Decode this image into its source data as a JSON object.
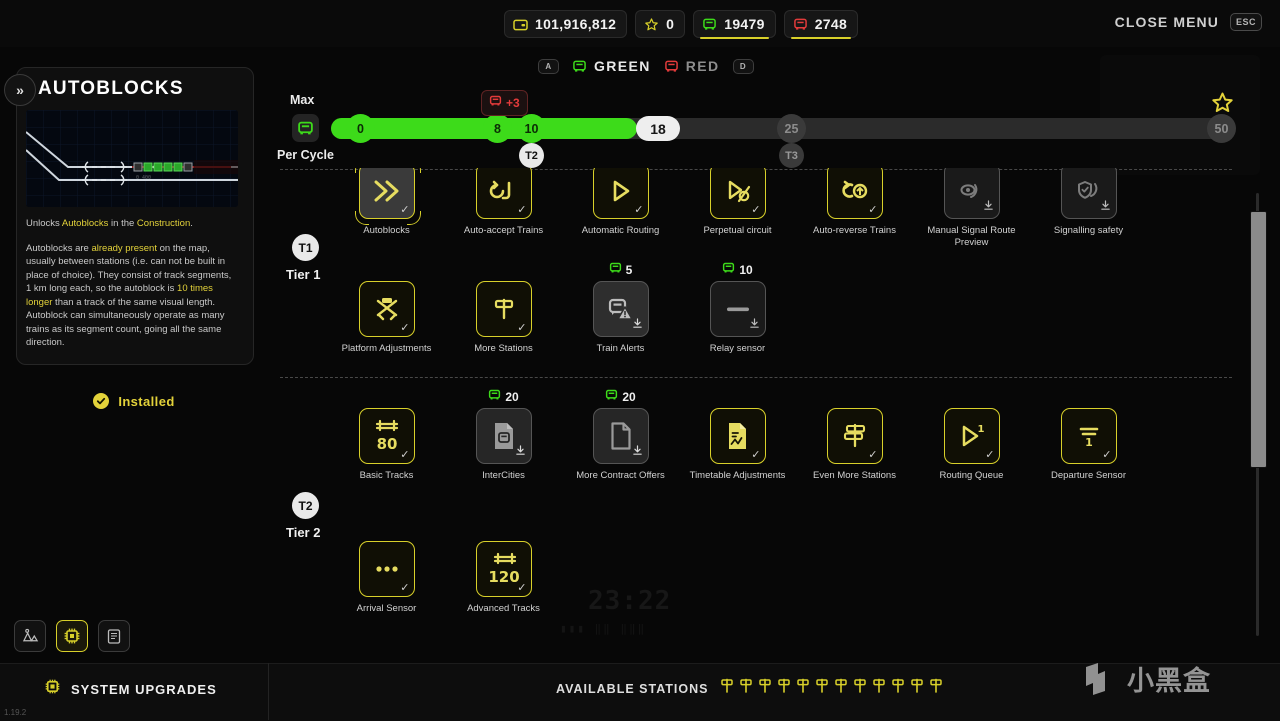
{
  "topbar": {
    "resources": [
      {
        "icon": "wallet-icon",
        "value": "101,916,812",
        "accent": "#d8d02a",
        "underline": false
      },
      {
        "icon": "star-icon",
        "value": "0",
        "accent": "#d8d02a",
        "underline": false
      },
      {
        "icon": "train-green-icon",
        "value": "19479",
        "accent": "#3ddb1a",
        "underline": true
      },
      {
        "icon": "train-red-icon",
        "value": "2748",
        "accent": "#e33b3b",
        "underline": true
      }
    ],
    "close_menu_label": "CLOSE MENU",
    "close_menu_key": "ESC"
  },
  "modes": {
    "left_key": "A",
    "right_key": "D",
    "items": [
      {
        "label": "GREEN",
        "color": "#3ddb1a"
      },
      {
        "label": "RED",
        "color": "#e33b3b"
      }
    ]
  },
  "detail_panel": {
    "collapse_icon": "»",
    "title": "AUTOBLOCKS",
    "unlock_line": {
      "pre": "Unlocks ",
      "hl1": "Autoblocks",
      "mid": " in the ",
      "hl2": "Construction",
      "post": "."
    },
    "description": {
      "s1": "Autoblocks are ",
      "hl1": "already present",
      "s2": " on the map, usually between stations (i.e. can not be built in place of choice). They consist of track segments, 1 km long each, so the autoblock is ",
      "hl2": "10 times longer",
      "s3": " than a track of the same visual length. Autoblock can simultaneously operate as many trains as its segment count, going all the same direction."
    },
    "status": "Installed"
  },
  "left_nav": {
    "items": [
      {
        "name": "construction-icon",
        "active": false
      },
      {
        "name": "chip-icon",
        "active": true
      },
      {
        "name": "book-icon",
        "active": false
      }
    ]
  },
  "bottom": {
    "system_upgrades_label": "SYSTEM UPGRADES",
    "version": "1.19.2",
    "available_stations_label": "AVAILABLE STATIONS",
    "available_stations_count": 12,
    "watermark": "小黑盒"
  },
  "slider": {
    "max_label": "Max",
    "per_cycle_label": "Per Cycle",
    "icon": "train-green-icon",
    "min": 0,
    "max": 50,
    "current": 18,
    "fill_end": 18,
    "stops": [
      {
        "value": 0,
        "label": "0",
        "pos_pct": 0,
        "active": true
      },
      {
        "value": 8,
        "label": "8",
        "pos_pct": 16,
        "active": true
      },
      {
        "value": 10,
        "label": "10",
        "pos_pct": 20,
        "active": true
      },
      {
        "value": 25,
        "label": "25",
        "pos_pct": 51,
        "active": false
      },
      {
        "value": 50,
        "label": "50",
        "pos_pct": 99,
        "active": false
      }
    ],
    "tier_markers": [
      {
        "label": "T2",
        "pos_pct": 20,
        "active": true
      },
      {
        "label": "T3",
        "pos_pct": 51,
        "active": false
      }
    ],
    "penalty_badge": {
      "icon": "train-red-icon",
      "text": "+3",
      "pos_pct": 16
    },
    "star_marker": "star-icon"
  },
  "upgrades": {
    "rows": [
      {
        "tier_chip": "",
        "tier_label": "",
        "items": [
          {
            "name": "Autoblocks",
            "icon": "chevrons-right-icon",
            "state": "selected",
            "mark": "check",
            "cost": null
          },
          {
            "name": "Auto-accept Trains",
            "icon": "auto-accept-icon",
            "state": "owned",
            "mark": "check",
            "cost": null
          },
          {
            "name": "Automatic Routing",
            "icon": "routing-icon",
            "state": "owned",
            "mark": "check",
            "cost": null
          },
          {
            "name": "Perpetual circuit",
            "icon": "perpetual-circuit-icon",
            "state": "owned",
            "mark": "check",
            "cost": null
          },
          {
            "name": "Auto-reverse Trains",
            "icon": "auto-reverse-icon",
            "state": "owned",
            "mark": "check",
            "cost": null
          },
          {
            "name": "Manual Signal Route Preview",
            "icon": "eye-signal-icon",
            "state": "locked",
            "mark": "download",
            "cost": null
          },
          {
            "name": "Signalling safety",
            "icon": "shield-signal-icon",
            "state": "locked",
            "mark": "download",
            "cost": null
          }
        ]
      },
      {
        "tier_chip": "T1",
        "tier_label": "Tier 1",
        "items": [
          {
            "name": "Platform Adjustments",
            "icon": "platform-adjust-icon",
            "state": "owned",
            "mark": "check",
            "cost": null
          },
          {
            "name": "More Stations",
            "icon": "signpost-icon",
            "state": "owned",
            "mark": "check",
            "cost": null
          },
          {
            "name": "Train Alerts",
            "icon": "train-alert-icon",
            "state": "locked",
            "mark": "download",
            "cost": {
              "icon": "train-green-icon",
              "value": "5"
            }
          },
          {
            "name": "Relay sensor",
            "icon": "relay-sensor-icon",
            "state": "locked",
            "mark": "download",
            "cost": {
              "icon": "train-green-icon",
              "value": "10"
            }
          }
        ]
      },
      {
        "tier_chip": "T2",
        "tier_label": "Tier 2",
        "items": [
          {
            "name": "Basic Tracks",
            "icon": "tracks-80-icon",
            "state": "owned",
            "mark": "check",
            "cost": null
          },
          {
            "name": "InterCities",
            "icon": "intercity-doc-icon",
            "state": "locked",
            "mark": "download",
            "cost": {
              "icon": "train-green-icon",
              "value": "20"
            }
          },
          {
            "name": "More Contract Offers",
            "icon": "document-icon",
            "state": "locked",
            "mark": "download",
            "cost": {
              "icon": "train-green-icon",
              "value": "20"
            }
          },
          {
            "name": "Timetable Adjustments",
            "icon": "timetable-icon",
            "state": "owned",
            "mark": "check",
            "cost": null
          },
          {
            "name": "Even More Stations",
            "icon": "double-signpost-icon",
            "state": "owned",
            "mark": "check",
            "cost": null
          },
          {
            "name": "Routing Queue",
            "icon": "routing-queue-icon",
            "state": "owned",
            "mark": "check",
            "cost": null
          },
          {
            "name": "Departure Sensor",
            "icon": "departure-sensor-icon",
            "state": "owned",
            "mark": "check",
            "cost": null
          }
        ]
      },
      {
        "tier_chip": "",
        "tier_label": "",
        "items": [
          {
            "name": "Arrival Sensor",
            "icon": "arrival-sensor-icon",
            "state": "owned",
            "mark": "check",
            "cost": null
          },
          {
            "name": "Advanced Tracks",
            "icon": "tracks-120-icon",
            "state": "owned",
            "mark": "check",
            "cost": null
          }
        ]
      }
    ],
    "tier2_chip": "T2",
    "tier2_label": "Tier 2"
  },
  "background": {
    "clock": "23:22",
    "clock_sub": "▮▮▮ ‖‖ ‖‖‖"
  }
}
